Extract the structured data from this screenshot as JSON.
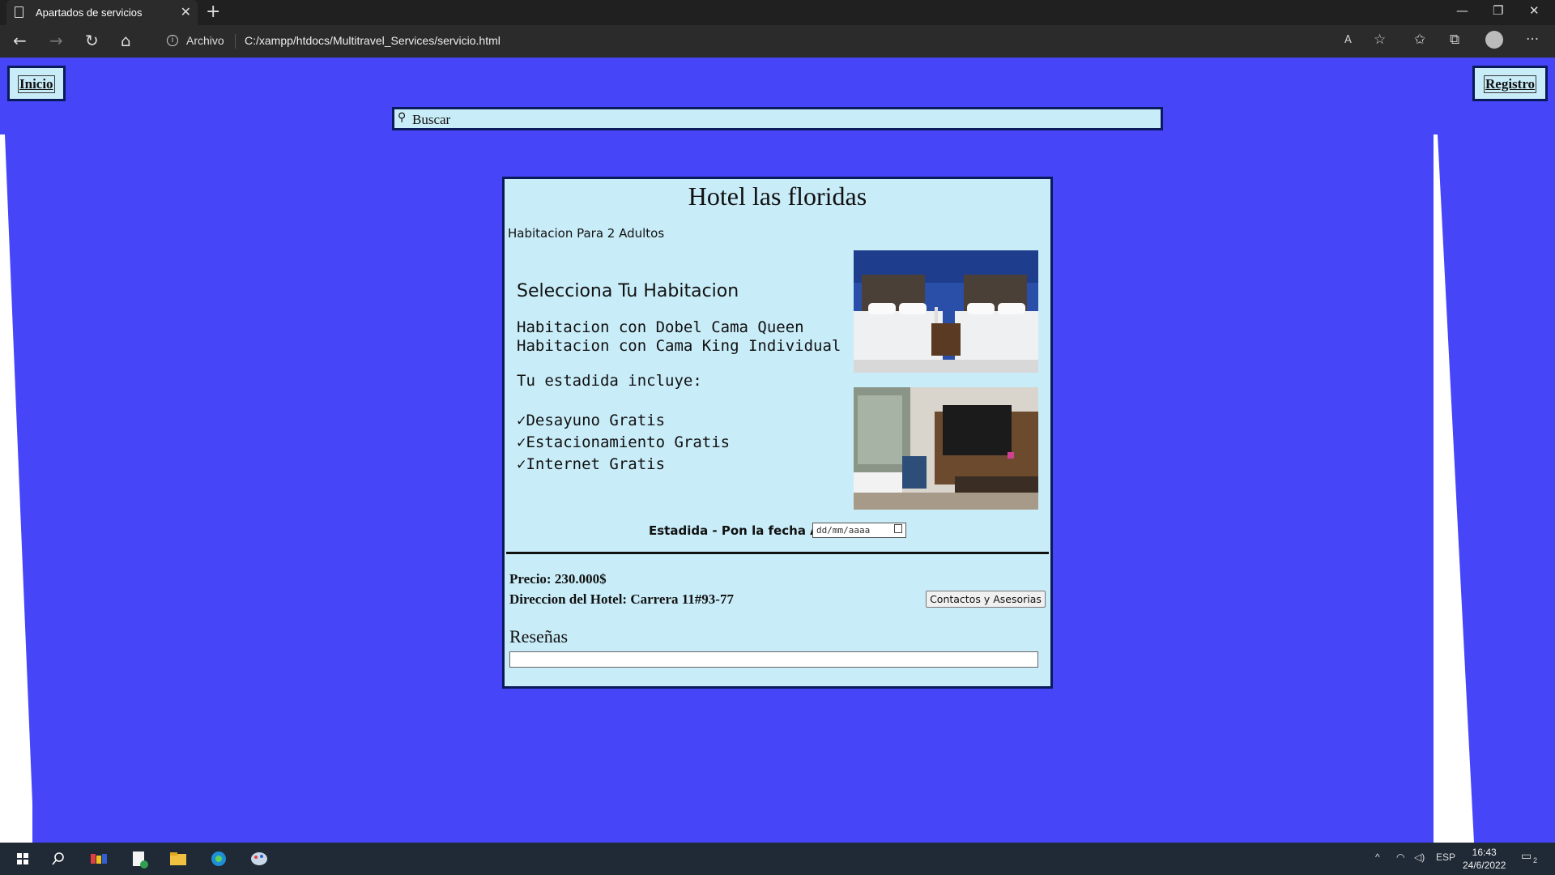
{
  "browser": {
    "tab_title": "Apartados de servicios",
    "tab_close": "✕",
    "new_tab": "+",
    "security_label": "Archivo",
    "url": "C:/xampp/htdocs/Multitravel_Services/servicio.html"
  },
  "nav": {
    "home_label": "Inicio",
    "register_label": "Registro"
  },
  "search": {
    "placeholder": "Buscar"
  },
  "hotel": {
    "title": "Hotel las floridas",
    "room_type": "Habitacion Para 2 Adultos",
    "select_heading": "Selecciona Tu Habitacion",
    "room_options": [
      "Habitacion con Dobel Cama Queen",
      "Habitacion con Cama King Individual"
    ],
    "includes_heading": "Tu estadida incluye:",
    "amenities": [
      "✓Desayuno Gratis",
      "✓Estacionamiento Gratis",
      "✓Internet Gratis"
    ],
    "date_label": "Estadida - Pon la fecha Aqui",
    "date_placeholder": "dd/mm/aaaa",
    "price": "Precio: 230.000$",
    "address": "Direccion del Hotel: Carrera 11#93-77",
    "contact_button": "Contactos y Asesorias",
    "reviews_heading": "Reseñas"
  },
  "taskbar": {
    "language": "ESP",
    "time": "16:43",
    "date": "24/6/2022",
    "notifications": "2"
  }
}
